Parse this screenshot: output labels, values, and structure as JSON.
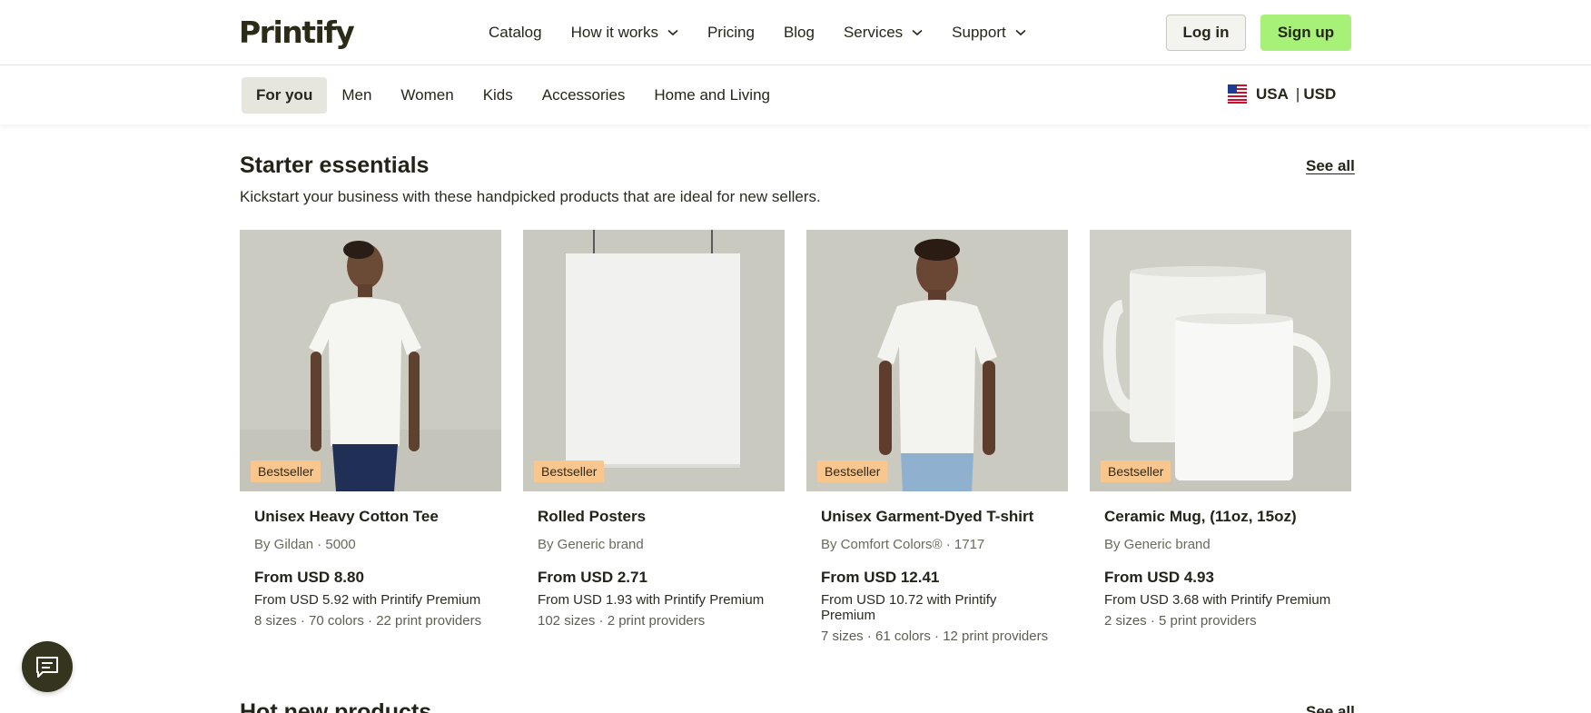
{
  "header": {
    "logo": "Printify",
    "nav": [
      {
        "label": "Catalog",
        "dropdown": false
      },
      {
        "label": "How it works",
        "dropdown": true
      },
      {
        "label": "Pricing",
        "dropdown": false
      },
      {
        "label": "Blog",
        "dropdown": false
      },
      {
        "label": "Services",
        "dropdown": true
      },
      {
        "label": "Support",
        "dropdown": true
      }
    ],
    "login_label": "Log in",
    "signup_label": "Sign up"
  },
  "categories": {
    "tabs": [
      "For you",
      "Men",
      "Women",
      "Kids",
      "Accessories",
      "Home and Living"
    ],
    "active_tab": "For you",
    "locale": {
      "country": "USA",
      "separator": "|",
      "currency": "USD"
    }
  },
  "section": {
    "title": "Starter essentials",
    "subtitle": "Kickstart your business with these handpicked products that are ideal for new sellers.",
    "see_all_label": "See all",
    "products": [
      {
        "badge": "Bestseller",
        "title": "Unisex Heavy Cotton Tee",
        "brand": "By Gildan · 5000",
        "price": "From USD 8.80",
        "premium": "From USD 5.92 with Printify Premium",
        "meta": "8 sizes · 70 colors · 22 print providers"
      },
      {
        "badge": "Bestseller",
        "title": "Rolled Posters",
        "brand": "By Generic brand",
        "price": "From USD 2.71",
        "premium": "From USD 1.93 with Printify Premium",
        "meta": "102 sizes · 2 print providers"
      },
      {
        "badge": "Bestseller",
        "title": "Unisex Garment-Dyed T-shirt",
        "brand": "By Comfort Colors® · 1717",
        "price": "From USD 12.41",
        "premium": "From USD 10.72 with Printify Premium",
        "meta": "7 sizes · 61 colors · 12 print providers"
      },
      {
        "badge": "Bestseller",
        "title": "Ceramic Mug, (11oz, 15oz)",
        "brand": "By Generic brand",
        "price": "From USD 4.93",
        "premium": "From USD 3.68 with Printify Premium",
        "meta": "2 sizes · 5 print providers"
      }
    ]
  },
  "next_section": {
    "title": "Hot new products",
    "see_all_label": "See all"
  },
  "colors": {
    "accent": "#a8f179",
    "badge": "#f9c78d",
    "text": "#23231a",
    "chat": "#34341f"
  }
}
